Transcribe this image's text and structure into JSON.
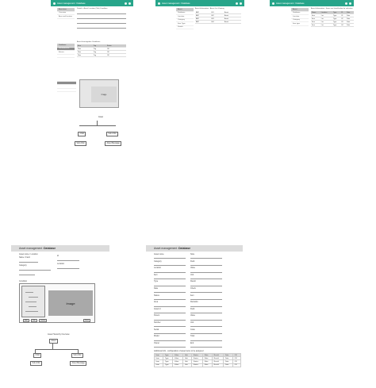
{
  "app": {
    "title": "Asset management : Database"
  },
  "screens_top": [
    {
      "title": "Asset management : Database"
    },
    {
      "title": "Asset management : Database"
    },
    {
      "title": "Asset management : Database"
    }
  ],
  "top_left": {
    "side": [
      "Asset tree",
      "Overview",
      "Area and location",
      "Database",
      "Document file",
      "Entries"
    ],
    "section1": "Details - Asset Location (Tab) Condition",
    "section2": "Asset Investigation Conditions",
    "table_headers": [
      "Item",
      "Tag",
      "Status"
    ],
    "table_rows": [
      [
        "Row",
        "Tag",
        "OK"
      ],
      [
        "Row",
        "Tag",
        "OK"
      ],
      [
        "Row",
        "Tag",
        "OK"
      ]
    ],
    "image_label": "Image",
    "tree_root": "Asset",
    "tree_children": [
      "Child",
      "Sub child",
      "Sub child",
      "Asset Message"
    ]
  },
  "top_mid": {
    "heading": "Asset Information - Asset List Viewing",
    "menu": [
      "Asset",
      "Database",
      "Location",
      "Category",
      "Item Type",
      "Details"
    ],
    "rows": [
      [
        "ABC",
        "001",
        "Asset"
      ],
      [
        "ABC",
        "002",
        "Asset"
      ],
      [
        "ABC",
        "003",
        "Asset"
      ],
      [
        "ABC",
        "004",
        "Asset"
      ]
    ]
  },
  "top_right": {
    "heading": "Asset Information - Items are listed below for selection",
    "menu": [
      "Asset",
      "Database",
      "Location",
      "Category",
      "Item type"
    ],
    "headers": [
      "Name",
      "Location",
      "Type",
      "ID",
      "Date"
    ],
    "rows": [
      [
        "Item",
        "Loc",
        "Type",
        "01",
        "Date"
      ],
      [
        "Item",
        "Loc",
        "Type",
        "02",
        "Date"
      ],
      [
        "Item",
        "Loc",
        "Type",
        "03",
        "Date"
      ],
      [
        "Item",
        "Loc",
        "Type",
        "04",
        "Date"
      ]
    ]
  },
  "bottom_left": {
    "title_plain": "Asset management : ",
    "title_bold": "Database",
    "label_name": "Asset name / Location",
    "label_a": "Name / Field",
    "label_b": "Id",
    "label_c": "Category",
    "label_d": "Location",
    "group_label": "Condition",
    "image_label": "Image",
    "tree_caption": "Asset Hierarchy Overview",
    "tree_root": "Asset",
    "tree_children": [
      "Child",
      "Sub child"
    ],
    "tree_leaves": [
      "Sub child",
      "Asset Message"
    ],
    "btns": [
      "Add",
      "Edit",
      "Delete",
      "Save"
    ]
  },
  "bottom_right": {
    "title_plain": "Asset management : ",
    "title_bold": "Database",
    "labels_l": [
      "Asset name",
      "Category",
      "Location",
      "Item",
      "Type",
      "Date",
      "Status",
      "Area",
      "Asset id",
      "Parent",
      "Number",
      "Serial",
      "Model",
      "Owner"
    ],
    "labels_r": [
      "Note",
      "Field",
      "Value",
      "Unit",
      "Result",
      "Check",
      "Item",
      "Remarks",
      "Field",
      "Value",
      "Unit",
      "Code",
      "Total",
      "End"
    ],
    "table_caption": "Additional info - configuration of asset items to be assigned",
    "table_headers": [
      "Item",
      "Type",
      "Value",
      "Unit",
      "Status",
      "Note",
      "Result",
      "Date",
      "OK"
    ],
    "table_rows": [
      [
        "Item",
        "Type",
        "Value",
        "Unit",
        "Status",
        "Note",
        "Result",
        "Date",
        "OK"
      ],
      [
        "Item",
        "Type",
        "Value",
        "Unit",
        "Status",
        "Note",
        "Result",
        "Date",
        "OK"
      ],
      [
        "Item",
        "Type",
        "Value",
        "Unit",
        "Status",
        "Note",
        "Result",
        "Date",
        "OK"
      ]
    ]
  },
  "colors": {
    "teal": "#27a58a",
    "header_grey": "#dcdcdc",
    "image_grey": "#a9a9a9"
  }
}
